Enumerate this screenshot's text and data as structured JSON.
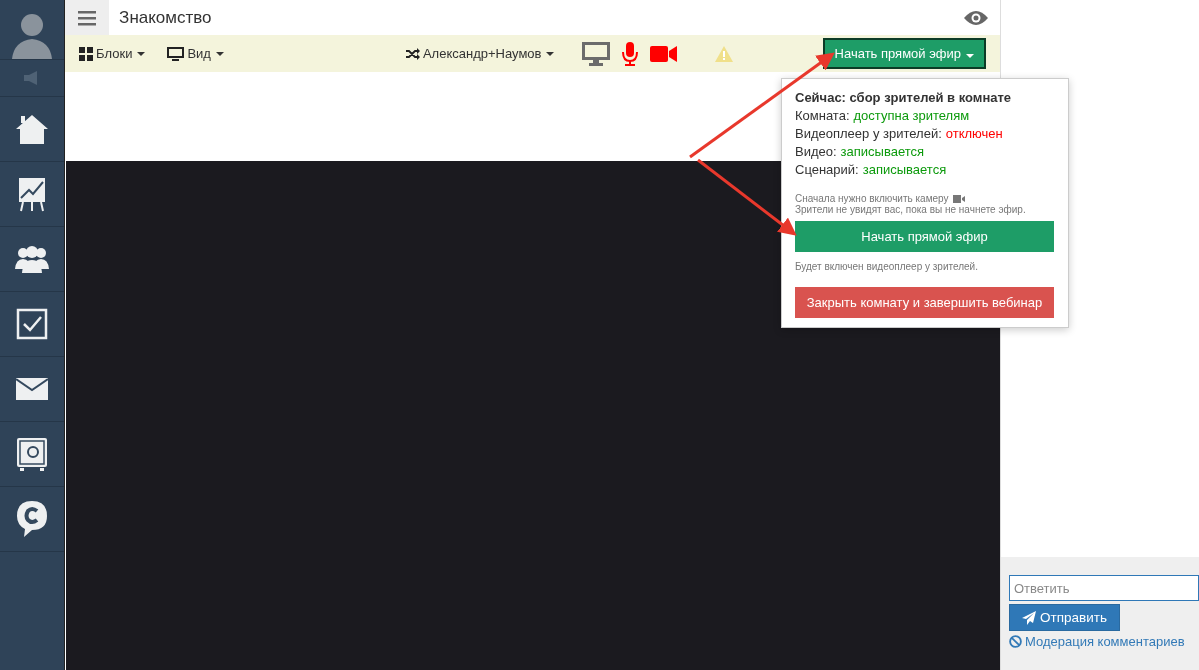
{
  "header": {
    "title": "Знакомство"
  },
  "sidebar": {
    "items": [
      {
        "kind": "avatar"
      },
      {
        "kind": "speaker"
      },
      {
        "kind": "home"
      },
      {
        "kind": "chart"
      },
      {
        "kind": "people"
      },
      {
        "kind": "check"
      },
      {
        "kind": "mail"
      },
      {
        "kind": "safe"
      },
      {
        "kind": "chat"
      }
    ]
  },
  "toolbar": {
    "blocks": "Блоки",
    "view": "Вид",
    "user": "Александр+Наумов",
    "media": [
      {
        "kind": "screen",
        "color": "#6b6b6b"
      },
      {
        "kind": "mic",
        "color": "#ff0000"
      },
      {
        "kind": "camera",
        "color": "#ff0000"
      }
    ],
    "live_button": "Начать прямой эфир"
  },
  "popup": {
    "heading": "Сейчас: сбор зрителей в комнате",
    "statuses": [
      {
        "label": "Комната:",
        "value": "доступна зрителям",
        "color": "#0c9a0c"
      },
      {
        "label": "Видеоплеер у зрителей:",
        "value": "отключен",
        "color": "#ff0000"
      },
      {
        "label": "Видео:",
        "value": "записывается",
        "color": "#0c9a0c"
      },
      {
        "label": "Сценарий:",
        "value": "записывается",
        "color": "#0c9a0c"
      }
    ],
    "camera_hint": "Сначала нужно включить камеру",
    "viewers_hint": "Зрители не увидят вас, пока вы не начнете эфир.",
    "start_button": "Начать прямой эфир",
    "player_hint": "Будет включен видеоплеер у зрителей.",
    "close_button": "Закрыть комнату и завершить вебинар"
  },
  "comments": {
    "placeholder": "Ответить",
    "send_button": "Отправить",
    "moderation_link": "Модерация комментариев"
  }
}
